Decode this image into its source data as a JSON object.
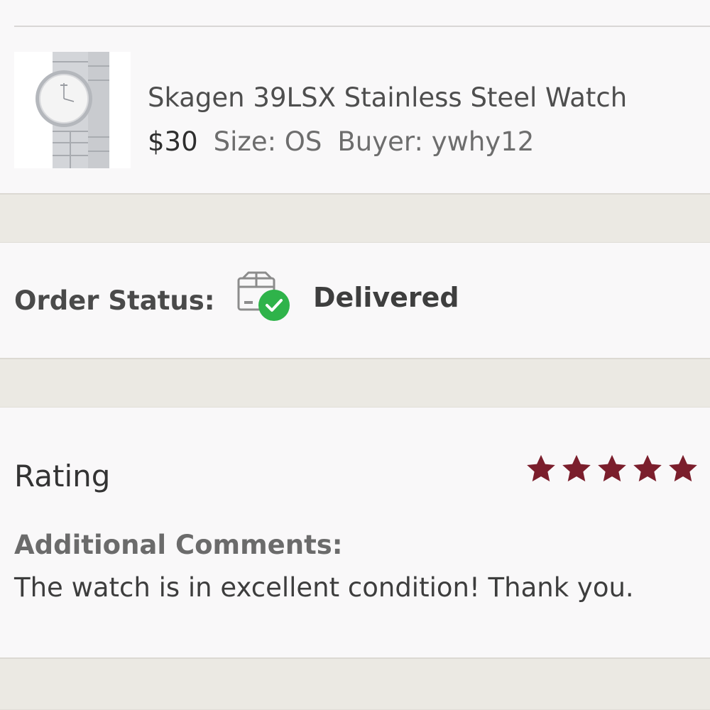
{
  "item": {
    "title": "Skagen 39LSX Stainless Steel Watch",
    "price": "$30",
    "size": "Size: OS",
    "buyer": "Buyer: ywhy12",
    "image_icon": "watch-photo"
  },
  "order_status": {
    "label": "Order Status:",
    "value": "Delivered",
    "icon": "package-delivered-icon",
    "check_color": "#2fb34a"
  },
  "rating": {
    "label": "Rating",
    "stars": 5,
    "max_stars": 5,
    "star_color": "#7b1e2c"
  },
  "comments": {
    "label": "Additional Comments:",
    "text": "The watch is in excellent condition! Thank you."
  },
  "colors": {
    "background": "#f9f8f9",
    "separator": "#ebe9e3"
  }
}
